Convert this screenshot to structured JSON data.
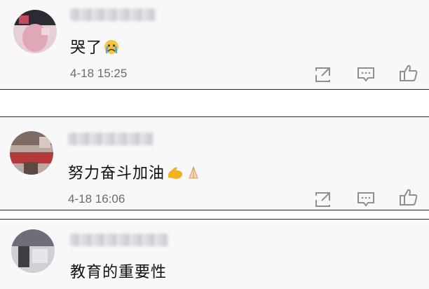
{
  "comments": [
    {
      "text": "哭了",
      "emoji_icon": "crying-face-icon",
      "timestamp": "4-18 15:25"
    },
    {
      "text": "努力奋斗加油",
      "emoji_icon": "flexed-biceps-and-praying-hands-icon",
      "timestamp": "4-18 16:06"
    },
    {
      "text": "教育的重要性"
    }
  ],
  "icons": {
    "share": "share-icon",
    "reply": "comment-icon",
    "like": "thumbs-up-icon"
  },
  "colors": {
    "card_bg": "#f8f7f9",
    "timestamp": "#6b6b70",
    "icon_gray": "#8e8e93"
  }
}
